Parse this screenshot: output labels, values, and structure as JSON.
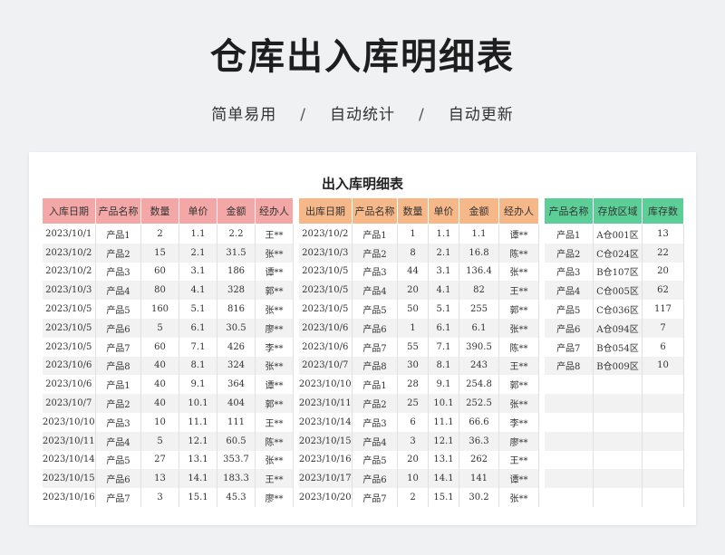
{
  "header": {
    "title": "仓库出入库明细表",
    "subtitle_items": [
      "简单易用",
      "自动统计",
      "自动更新"
    ],
    "separator": "/"
  },
  "sheet": {
    "title": "出入库明细表",
    "colors": {
      "inbound_header": "#f4a7a7",
      "outbound_header": "#f7b889",
      "stock_header": "#5ccf98",
      "stripe": "#f2f2f2"
    }
  },
  "inbound": {
    "columns": [
      "入库日期",
      "产品名称",
      "数量",
      "单价",
      "金额",
      "经办人"
    ],
    "rows": [
      [
        "2023/10/1",
        "产品1",
        "2",
        "1.1",
        "2.2",
        "王**"
      ],
      [
        "2023/10/2",
        "产品2",
        "15",
        "2.1",
        "31.5",
        "张**"
      ],
      [
        "2023/10/2",
        "产品3",
        "60",
        "3.1",
        "186",
        "谭**"
      ],
      [
        "2023/10/3",
        "产品4",
        "80",
        "4.1",
        "328",
        "郭**"
      ],
      [
        "2023/10/5",
        "产品5",
        "160",
        "5.1",
        "816",
        "张**"
      ],
      [
        "2023/10/5",
        "产品6",
        "5",
        "6.1",
        "30.5",
        "廖**"
      ],
      [
        "2023/10/5",
        "产品7",
        "60",
        "7.1",
        "426",
        "李**"
      ],
      [
        "2023/10/6",
        "产品8",
        "40",
        "8.1",
        "324",
        "张**"
      ],
      [
        "2023/10/6",
        "产品1",
        "40",
        "9.1",
        "364",
        "谭**"
      ],
      [
        "2023/10/7",
        "产品2",
        "40",
        "10.1",
        "404",
        "郭**"
      ],
      [
        "2023/10/10",
        "产品3",
        "10",
        "11.1",
        "111",
        "王**"
      ],
      [
        "2023/10/11",
        "产品4",
        "5",
        "12.1",
        "60.5",
        "陈**"
      ],
      [
        "2023/10/14",
        "产品5",
        "27",
        "13.1",
        "353.7",
        "张**"
      ],
      [
        "2023/10/15",
        "产品6",
        "13",
        "14.1",
        "183.3",
        "王**"
      ],
      [
        "2023/10/16",
        "产品7",
        "3",
        "15.1",
        "45.3",
        "廖**"
      ]
    ]
  },
  "outbound": {
    "columns": [
      "出库日期",
      "产品名称",
      "数量",
      "单价",
      "金额",
      "经办人"
    ],
    "rows": [
      [
        "2023/10/2",
        "产品1",
        "1",
        "1.1",
        "1.1",
        "谭**"
      ],
      [
        "2023/10/3",
        "产品2",
        "8",
        "2.1",
        "16.8",
        "陈**"
      ],
      [
        "2023/10/5",
        "产品3",
        "44",
        "3.1",
        "136.4",
        "张**"
      ],
      [
        "2023/10/5",
        "产品4",
        "20",
        "4.1",
        "82",
        "王**"
      ],
      [
        "2023/10/5",
        "产品5",
        "50",
        "5.1",
        "255",
        "郭**"
      ],
      [
        "2023/10/6",
        "产品6",
        "1",
        "6.1",
        "6.1",
        "张**"
      ],
      [
        "2023/10/6",
        "产品7",
        "55",
        "7.1",
        "390.5",
        "陈**"
      ],
      [
        "2023/10/7",
        "产品8",
        "30",
        "8.1",
        "243",
        "王**"
      ],
      [
        "2023/10/10",
        "产品1",
        "28",
        "9.1",
        "254.8",
        "郭**"
      ],
      [
        "2023/10/11",
        "产品2",
        "25",
        "10.1",
        "252.5",
        "张**"
      ],
      [
        "2023/10/14",
        "产品3",
        "6",
        "11.1",
        "66.6",
        "李**"
      ],
      [
        "2023/10/15",
        "产品4",
        "3",
        "12.1",
        "36.3",
        "廖**"
      ],
      [
        "2023/10/16",
        "产品5",
        "20",
        "13.1",
        "262",
        "王**"
      ],
      [
        "2023/10/17",
        "产品6",
        "10",
        "14.1",
        "141",
        "谭**"
      ],
      [
        "2023/10/20",
        "产品7",
        "2",
        "15.1",
        "30.2",
        "张**"
      ]
    ]
  },
  "stock": {
    "columns": [
      "产品名称",
      "存放区域",
      "库存数"
    ],
    "rows": [
      [
        "产品1",
        "A仓001区",
        "13"
      ],
      [
        "产品2",
        "C仓024区",
        "22"
      ],
      [
        "产品3",
        "B仓107区",
        "20"
      ],
      [
        "产品4",
        "C仓005区",
        "62"
      ],
      [
        "产品5",
        "C仓036区",
        "117"
      ],
      [
        "产品6",
        "A仓094区",
        "7"
      ],
      [
        "产品7",
        "B仓054区",
        "6"
      ],
      [
        "产品8",
        "B仓009区",
        "10"
      ],
      [
        "",
        "",
        ""
      ],
      [
        "",
        "",
        ""
      ],
      [
        "",
        "",
        ""
      ],
      [
        "",
        "",
        ""
      ],
      [
        "",
        "",
        ""
      ],
      [
        "",
        "",
        ""
      ],
      [
        "",
        "",
        ""
      ]
    ]
  }
}
